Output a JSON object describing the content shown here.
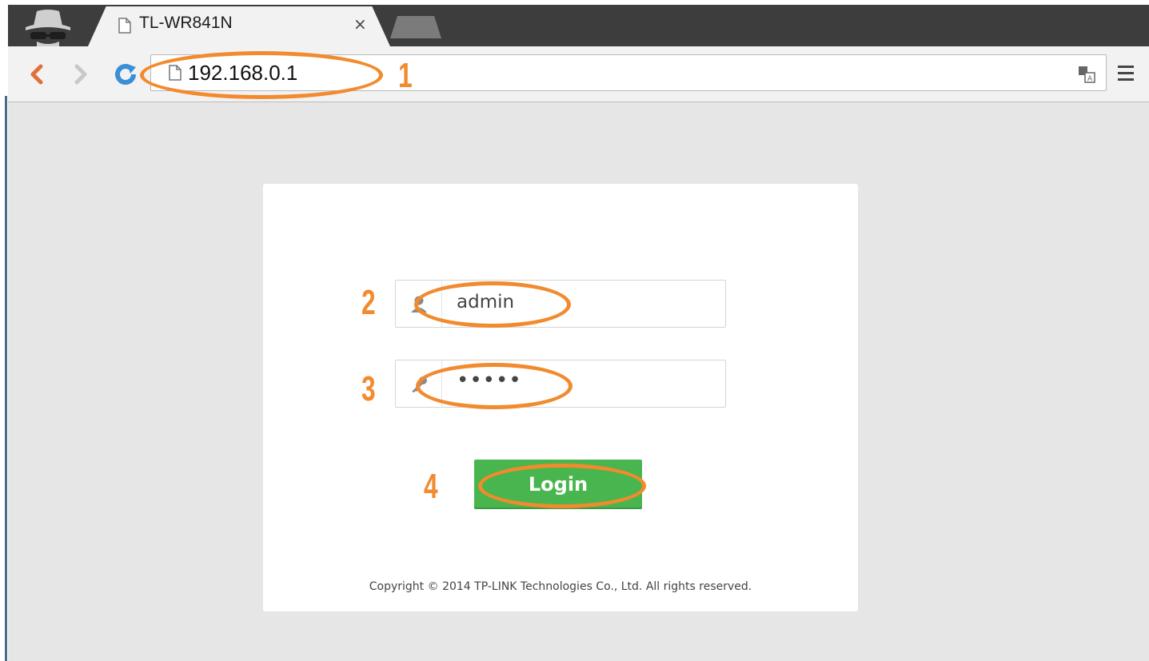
{
  "browser": {
    "tab_title": "TL-WR841N",
    "tab_close": "×",
    "url": "192.168.0.1"
  },
  "login": {
    "username_value": "admin",
    "password_mask": "•••••",
    "login_button": "Login",
    "copyright": "Copyright © 2014 TP-LINK Technologies Co., Ltd. All rights reserved."
  },
  "annotations": {
    "step1": "1",
    "step2": "2",
    "step3": "3",
    "step4": "4",
    "color": "#f28a2e"
  },
  "colors": {
    "login_button": "#49b54e",
    "page_background": "#e6e6e6"
  }
}
